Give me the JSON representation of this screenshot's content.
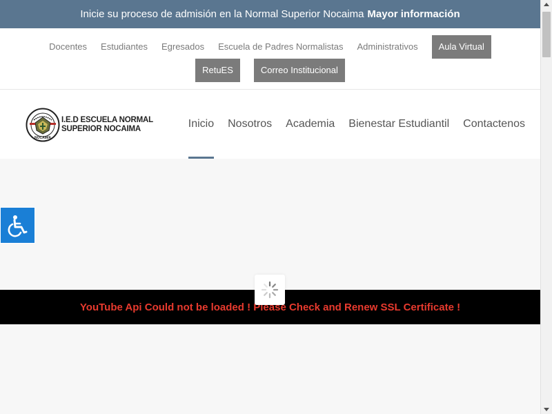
{
  "topbar": {
    "text": "Inicie su proceso de admisión en la Normal Superior Nocaima",
    "link": "Mayor información"
  },
  "secondary_nav": {
    "links": [
      "Docentes",
      "Estudiantes",
      "Egresados",
      "Escuela de Padres Normalistas",
      "Administrativos"
    ],
    "aula_virtual": "Aula Virtual",
    "retues": "RetuES",
    "correo": "Correo Institucional"
  },
  "logo": {
    "line1": "I.E.D ESCUELA NORMAL",
    "line2": "SUPERIOR NOCAIMA",
    "seal_text": "NOCAIMA"
  },
  "main_nav": {
    "items": [
      "Inicio",
      "Nosotros",
      "Academia",
      "Bienestar Estudiantil",
      "Contactenos"
    ],
    "active": "Inicio"
  },
  "error_message": "YouTube Api Could not be loaded ! Please Check and Renew SSL Certificate !",
  "icons": {
    "accessibility": "wheelchair-icon",
    "loader": "spinner-icon"
  },
  "colors": {
    "topbar": "#5a7690",
    "accessibility_button": "#1a7fd6",
    "error_text": "#e83a2e",
    "nav_button": "#7b7b7b"
  }
}
